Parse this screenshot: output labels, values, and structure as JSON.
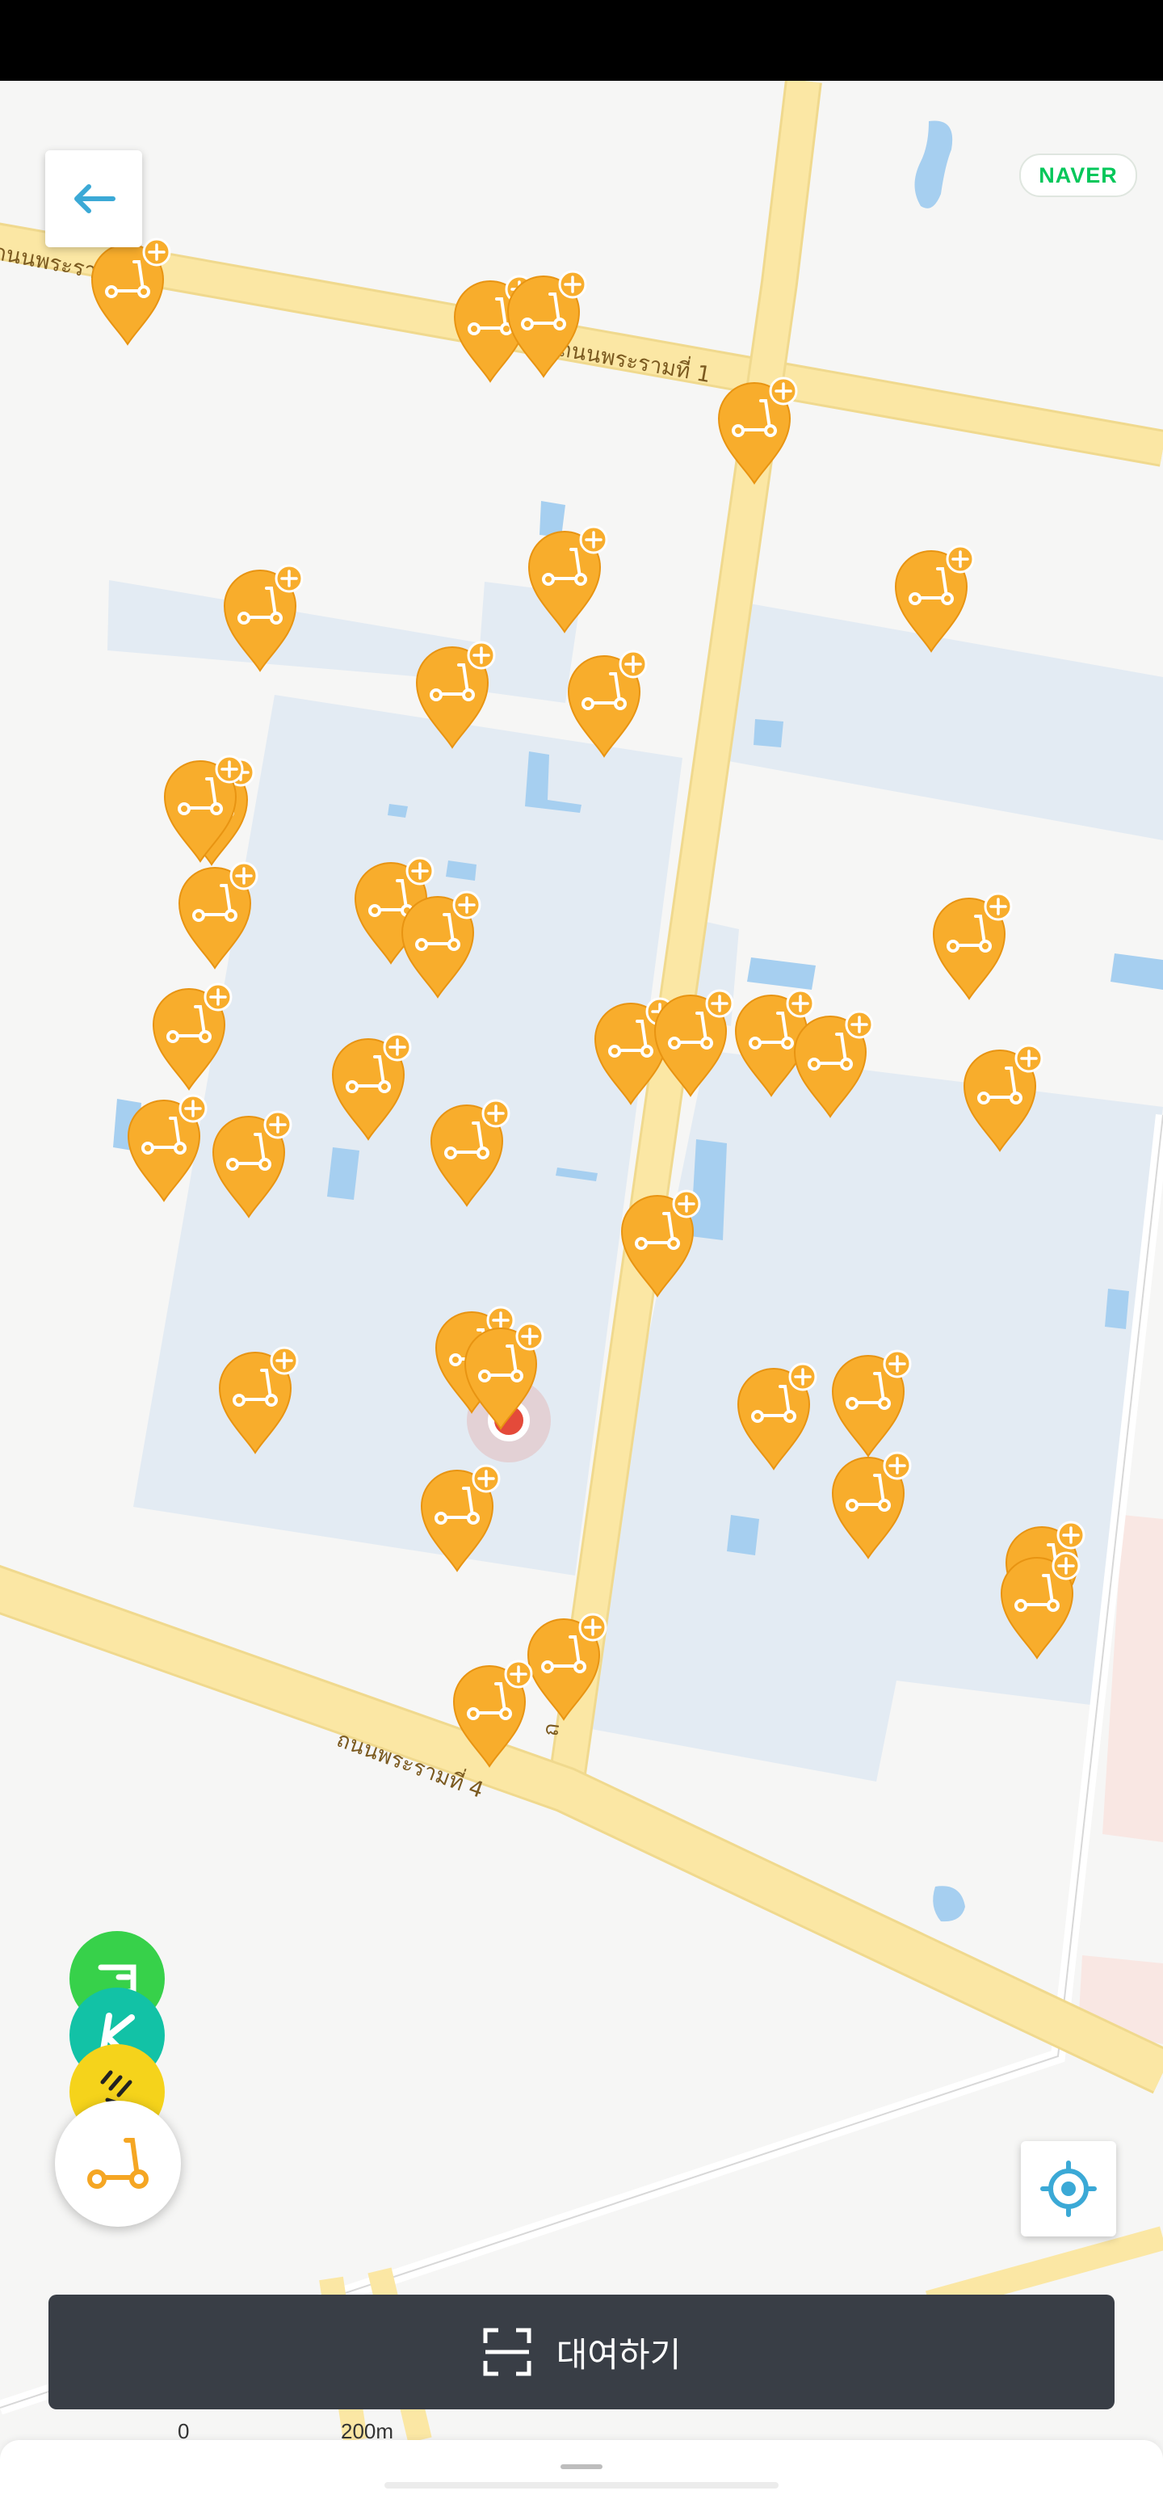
{
  "status_bar": {},
  "map": {
    "provider_logo": "NAVER",
    "road_labels": [
      "ถนนพระรามที่ 1",
      "ถนนพระรามที่ 1",
      "ถนนพระรามที่ 4",
      "ถ"
    ],
    "scooter_pin_count": 44
  },
  "controls": {
    "back_icon": "arrow-left-icon",
    "locate_icon": "crosshair-icon",
    "scooter_icon": "kick-scooter-icon",
    "brands": [
      "green-scooter-brand-icon",
      "k-brand-icon",
      "yellow-brand-icon"
    ]
  },
  "rent_button": {
    "label": "대여하기",
    "icon": "scan-qr-icon"
  },
  "scale_bar": {
    "start": "0",
    "end": "200m"
  },
  "colors": {
    "pin": "#f8ad2c",
    "road": "#fbe7a4",
    "building": "#e3ebf3",
    "water": "#a6cff0",
    "button_dark": "#393e46",
    "accent": "#3ba9d6",
    "location": "#e44a3a"
  }
}
